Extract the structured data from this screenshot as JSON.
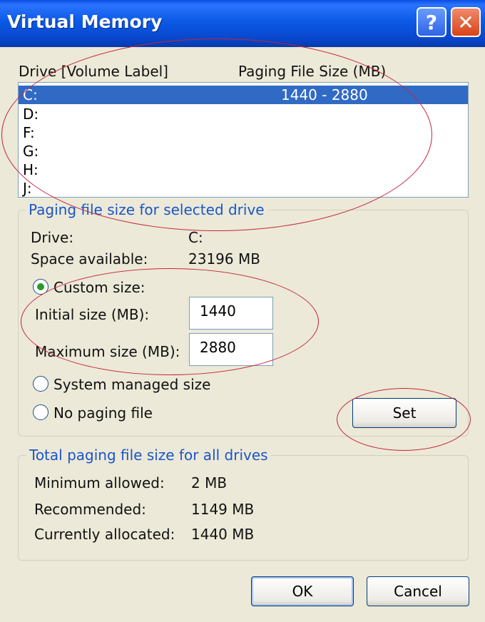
{
  "window": {
    "title": "Virtual Memory",
    "help_glyph": "?",
    "close_glyph": "✕"
  },
  "drive_list": {
    "header_drive": "Drive  [Volume Label]",
    "header_size": "Paging File Size (MB)",
    "items": [
      {
        "letter": "C:",
        "size": "1440 - 2880"
      },
      {
        "letter": "D:",
        "size": ""
      },
      {
        "letter": "F:",
        "size": ""
      },
      {
        "letter": "G:",
        "size": ""
      },
      {
        "letter": "H:",
        "size": ""
      },
      {
        "letter": "J:",
        "size": ""
      }
    ]
  },
  "selected_drive": {
    "group_title": "Paging file size for selected drive",
    "drive_label": "Drive:",
    "drive_value": "C:",
    "space_label": "Space available:",
    "space_value": "23196 MB",
    "custom_label": "Custom size:",
    "initial_label": "Initial size (MB):",
    "initial_value": "1440",
    "maximum_label": "Maximum size (MB):",
    "maximum_value": "2880",
    "system_label": "System managed size",
    "nopaging_label": "No paging file",
    "set_label": "Set",
    "selected_option": "custom"
  },
  "total": {
    "group_title": "Total paging file size for all drives",
    "min_label": "Minimum allowed:",
    "min_value": "2 MB",
    "rec_label": "Recommended:",
    "rec_value": "1149 MB",
    "cur_label": "Currently allocated:",
    "cur_value": "1440 MB"
  },
  "buttons": {
    "ok": "OK",
    "cancel": "Cancel"
  },
  "colors": {
    "titlebar": "#0b5ae6",
    "selection": "#316ac5",
    "annotation": "#c3253a",
    "group_title": "#1a56c8"
  }
}
